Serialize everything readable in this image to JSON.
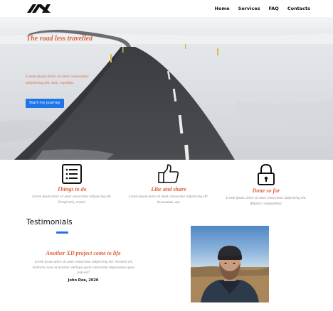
{
  "nav": {
    "items": [
      "Home",
      "Services",
      "FAQ",
      "Contacts"
    ]
  },
  "hero": {
    "title": "The road less travelled",
    "text": "Lorem ipsum dolor sit amet consectetur adipisicing elit. Iure, expedita.",
    "button_label": "Start my journey"
  },
  "features": [
    {
      "icon": "list-icon",
      "title": "Things to do",
      "text": "Lorem ipsum dolor sit amet consectetur adipisicing elit. Perspicatis, rerum!"
    },
    {
      "icon": "thumbs-up-icon",
      "title": "Like and share",
      "text": "Lorem ipsum dolor sit amet consectetur adipisicing elit. Accusamus, aut."
    },
    {
      "icon": "lock-icon",
      "title": "Done so far",
      "text": "Lorem ipsum, dolor sit amet consectetur adipisicing elit. Adipisci, voluptatibus!"
    }
  ],
  "testimonials": {
    "heading": "Testimonials",
    "title": "Another XD project come to life",
    "text": "Lorem ipsum dolor sit amet consectetur adipisicing elit. Veritatis vel, distinctio iusto at maxime similique quod consectetur dignissimos quasi placeat?",
    "author": "John Doe, 2020"
  },
  "colors": {
    "accent": "#e0603a",
    "button": "#1e74e8",
    "muted_text": "#888888"
  }
}
